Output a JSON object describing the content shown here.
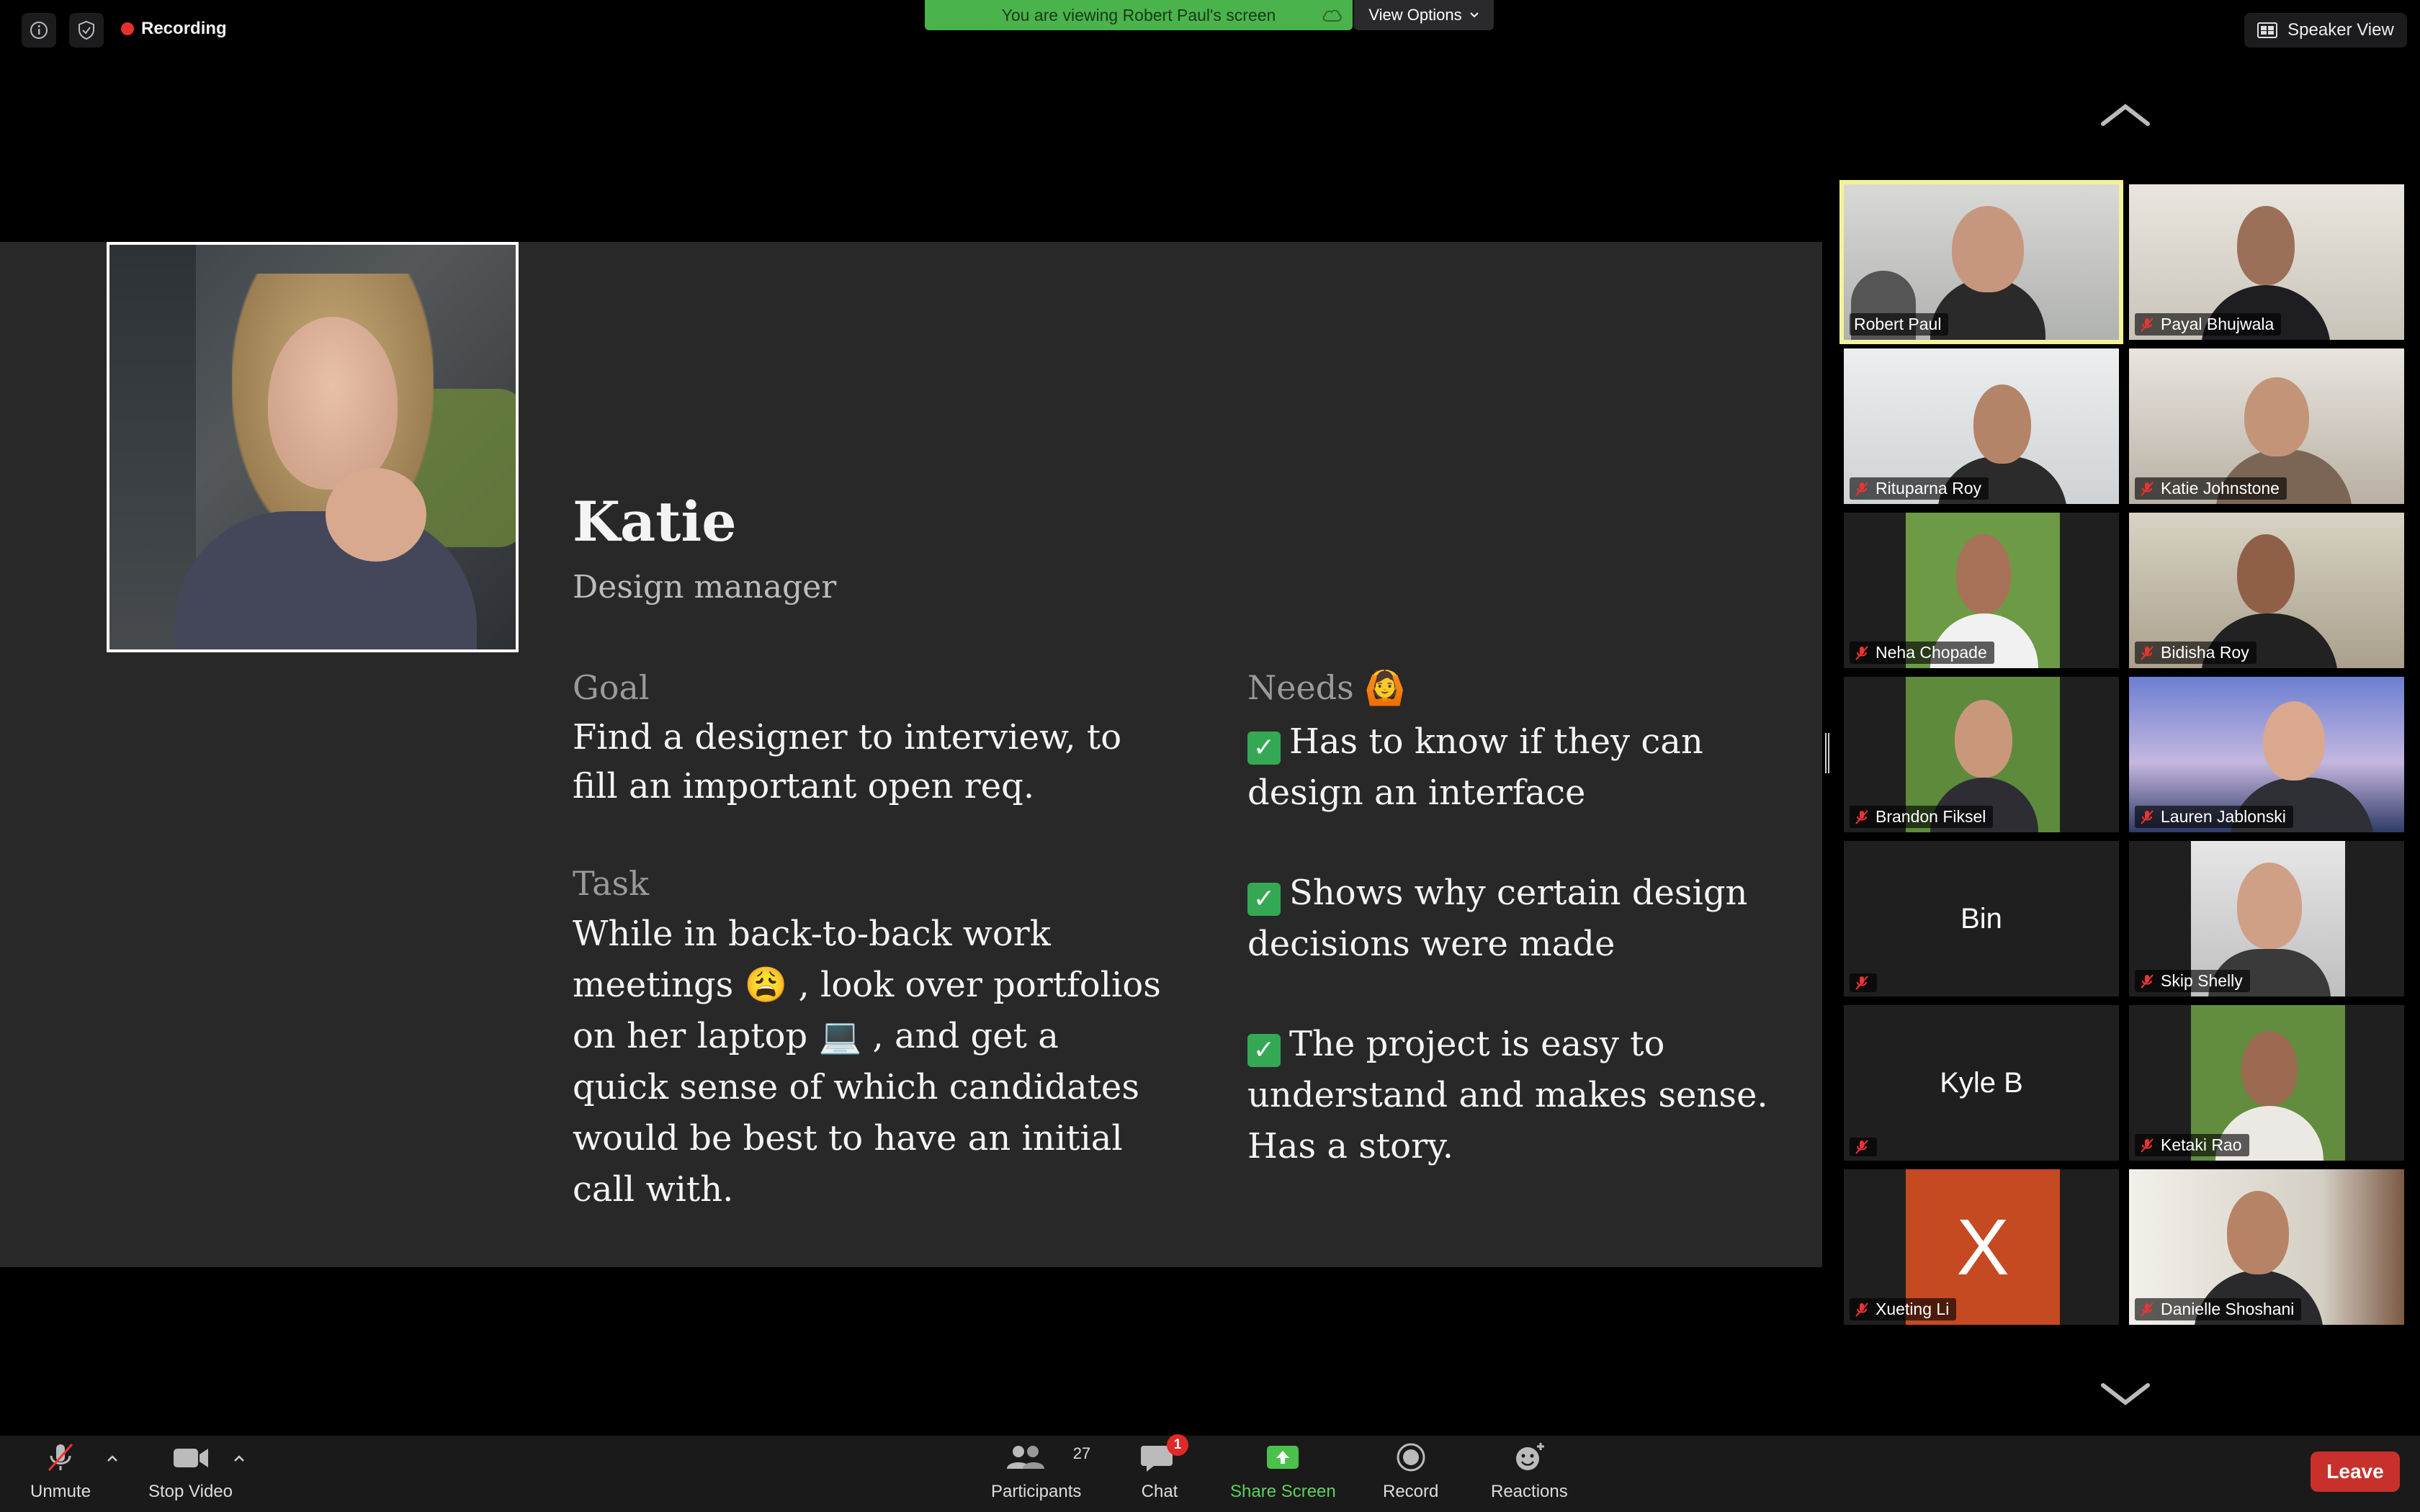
{
  "top_bar": {
    "recording_label": "Recording",
    "viewing_banner": "You are viewing Robert Paul's screen",
    "view_options_label": "View Options",
    "speaker_view_label": "Speaker View"
  },
  "slide": {
    "name": "Katie",
    "role": "Design manager",
    "goal_heading": "Goal",
    "goal_text": "Find a designer to interview, to fill an important open req.",
    "task_heading": "Task",
    "task_text_1": "While in back-to-back work meetings ",
    "task_emoji_1": "😩",
    "task_text_2": " , look over portfolios on her laptop ",
    "task_emoji_2": "💻",
    "task_text_3": " , and get a quick sense of which candidates would be best to have an initial call with.",
    "needs_heading": "Needs",
    "needs_emoji": "🙆",
    "needs": [
      "Has to know if they can design an interface",
      "Shows why certain design decisions were made",
      "The project is easy to understand and makes sense. Has a story."
    ]
  },
  "participants": [
    {
      "name": "Robert Paul",
      "muted": false,
      "active": true,
      "type": "video"
    },
    {
      "name": "Payal Bhujwala",
      "muted": true,
      "type": "video"
    },
    {
      "name": "Rituparna Roy",
      "muted": true,
      "type": "video"
    },
    {
      "name": "Katie Johnstone",
      "muted": true,
      "type": "video"
    },
    {
      "name": "Neha Chopade",
      "muted": true,
      "type": "video"
    },
    {
      "name": "Bidisha Roy",
      "muted": true,
      "type": "video"
    },
    {
      "name": "Brandon Fiksel",
      "muted": true,
      "type": "video"
    },
    {
      "name": "Lauren Jablonski",
      "muted": true,
      "type": "video"
    },
    {
      "name": "",
      "initials": "Bin",
      "muted": true,
      "type": "text"
    },
    {
      "name": "Skip Shelly",
      "muted": true,
      "type": "video"
    },
    {
      "name": "",
      "initials": "Kyle B",
      "muted": true,
      "type": "text"
    },
    {
      "name": "Ketaki Rao",
      "muted": true,
      "type": "video"
    },
    {
      "name": "Xueting Li",
      "initials": "X",
      "muted": true,
      "type": "avatar"
    },
    {
      "name": "Danielle Shoshani",
      "muted": true,
      "type": "video"
    }
  ],
  "toolbar": {
    "unmute_label": "Unmute",
    "stop_video_label": "Stop Video",
    "participants_label": "Participants",
    "participants_count": "27",
    "chat_label": "Chat",
    "chat_badge": "1",
    "share_screen_label": "Share Screen",
    "record_label": "Record",
    "reactions_label": "Reactions",
    "leave_label": "Leave"
  },
  "colors": {
    "active_speaker_border": "#f2f29a",
    "share_green": "#4bb34b",
    "leave_red": "#c8312b",
    "recording_red": "#e5312b"
  }
}
